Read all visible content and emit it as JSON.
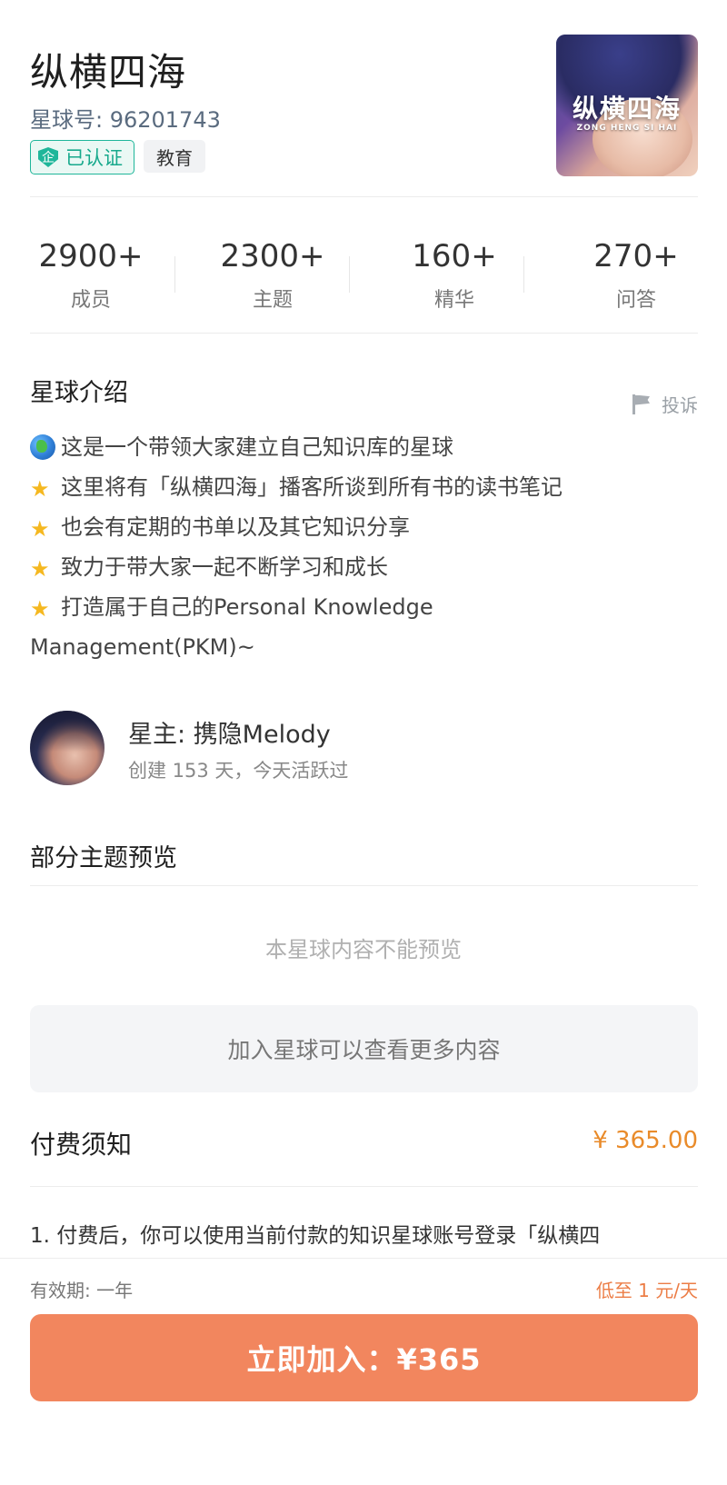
{
  "header": {
    "title": "纵横四海",
    "planet_id": "星球号: 96201743",
    "verified_label": "已认证",
    "verified_icon_glyph": "企",
    "category_tag": "教育",
    "cover": {
      "text": "纵横四海",
      "subtext": "ZONG HENG SI HAI"
    }
  },
  "stats": [
    {
      "value": "2900+",
      "label": "成员"
    },
    {
      "value": "2300+",
      "label": "主题"
    },
    {
      "value": "160+",
      "label": "精华"
    },
    {
      "value": "270+",
      "label": "问答"
    }
  ],
  "intro": {
    "title": "星球介绍",
    "report_label": "投诉",
    "lines": [
      {
        "icon": "globe-emoji",
        "text": "这是一个带领大家建立自己知识库的星球"
      },
      {
        "icon": "star-emoji",
        "text": "这里将有「纵横四海」播客所谈到所有书的读书笔记"
      },
      {
        "icon": "star-emoji",
        "text": "也会有定期的书单以及其它知识分享"
      },
      {
        "icon": "star-emoji",
        "text": "致力于带大家一起不断学习和成长"
      },
      {
        "icon": "star-emoji",
        "text": "打造属于自己的Personal Knowledge"
      }
    ],
    "continuation": "Management(PKM)~"
  },
  "owner": {
    "name": "星主: 携隐Melody",
    "meta": "创建 153 天，今天活跃过"
  },
  "preview": {
    "title": "部分主题预览",
    "empty_text": "本星球内容不能预览",
    "join_more": "加入星球可以查看更多内容"
  },
  "fee": {
    "title": "付费须知",
    "price": "¥ 365.00",
    "note": "1. 付费后，你可以使用当前付款的知识星球账号登录「纵横四"
  },
  "bottom": {
    "validity": "有效期: 一年",
    "per_day": "低至 1 元/天",
    "join_button": "立即加入：¥365"
  },
  "colors": {
    "accent": "#f2865e",
    "price": "#e98b2a",
    "verified": "#1fb69a"
  }
}
